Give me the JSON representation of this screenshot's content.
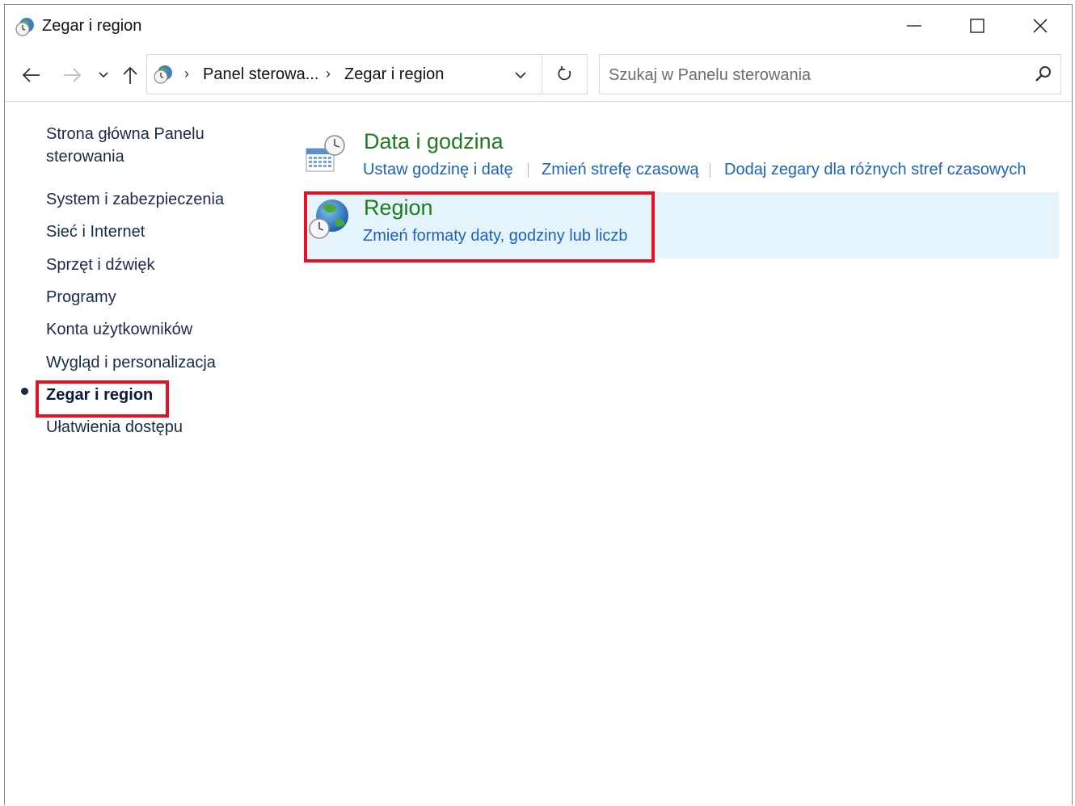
{
  "window": {
    "title": "Zegar i region"
  },
  "navigation": {
    "breadcrumbs": [
      "Panel sterowa...",
      "Zegar i region"
    ],
    "search_placeholder": "Szukaj w Panelu sterowania"
  },
  "sidebar": {
    "home_label": "Strona główna Panelu sterowania",
    "items": [
      {
        "label": "System i zabezpieczenia",
        "current": false
      },
      {
        "label": "Sieć i Internet",
        "current": false
      },
      {
        "label": "Sprzęt i dźwięk",
        "current": false
      },
      {
        "label": "Programy",
        "current": false
      },
      {
        "label": "Konta użytkowników",
        "current": false
      },
      {
        "label": "Wygląd i personalizacja",
        "current": false
      },
      {
        "label": "Zegar i region",
        "current": true
      },
      {
        "label": "Ułatwienia dostępu",
        "current": false
      }
    ]
  },
  "main": {
    "categories": [
      {
        "title": "Data i godzina",
        "icon": "calendar-clock-icon",
        "tasks": [
          "Ustaw godzinę i datę",
          "Zmień strefę czasową",
          "Dodaj zegary dla różnych stref czasowych"
        ]
      },
      {
        "title": "Region",
        "icon": "globe-clock-icon",
        "highlighted": true,
        "tasks": [
          "Zmień formaty daty, godziny lub liczb"
        ]
      }
    ]
  },
  "colors": {
    "category_title": "#1e7b1e",
    "task_link": "#1a62c8",
    "highlight_box": "#e81123",
    "hover_background": "#e5f3fb"
  }
}
